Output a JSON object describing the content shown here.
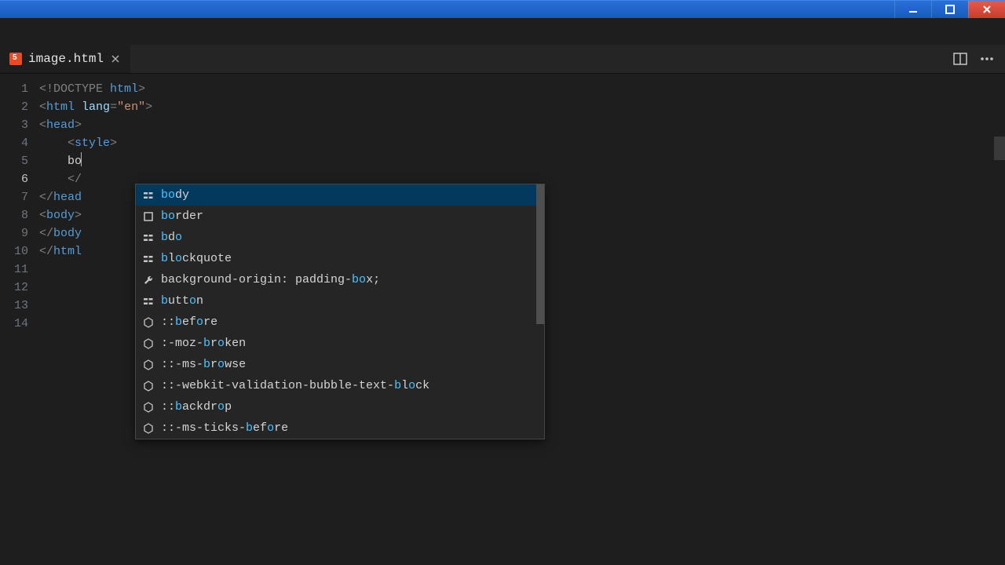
{
  "tab": {
    "filename": "image.html"
  },
  "gutter": [
    1,
    2,
    3,
    4,
    5,
    6,
    7,
    8,
    9,
    10,
    11,
    12,
    13,
    14
  ],
  "current_line": 6,
  "code": {
    "l1_pre": "<!DOCTYPE ",
    "l1_tag": "html",
    "l1_post": ">",
    "l2_pre": "<",
    "l2_tag": "html",
    "l2_sp": " ",
    "l2_attr": "lang",
    "l2_eq": "=",
    "l2_str": "\"en\"",
    "l2_post": ">",
    "l3_pre": "<",
    "l3_tag": "head",
    "l3_post": ">",
    "l4_ind": "    ",
    "l4_pre": "<",
    "l4_tag": "style",
    "l4_post": ">",
    "l5": "",
    "l6_ind": "    ",
    "l6_txt": "bo",
    "l7": "",
    "l8": "",
    "l9_ind": "    ",
    "l9_pre": "</",
    "l10_pre": "</",
    "l10_tag": "head",
    "l11_pre": "<",
    "l11_tag": "body",
    "l11_post": ">",
    "l12": "",
    "l13_pre": "</",
    "l13_tag": "body",
    "l14_pre": "</",
    "l14_tag": "html"
  },
  "suggest": {
    "items": [
      {
        "kind": "snippet",
        "pre": "bo",
        "rest": "dy"
      },
      {
        "kind": "square",
        "pre": "bo",
        "rest": "rder"
      },
      {
        "kind": "snippet",
        "pre": "b",
        "rest": "d",
        "post": "o"
      },
      {
        "kind": "snippet",
        "pre": "b",
        "rest": "l",
        "post": "o",
        "tail": "ckquote"
      },
      {
        "kind": "wrench",
        "full1": "background-origin: padding-",
        "match": "bo",
        "full2": "x;"
      },
      {
        "kind": "snippet",
        "pre": "b",
        "rest": "utt",
        "post": "o",
        "tail": "n"
      },
      {
        "kind": "hex",
        "full1": "::",
        "match": "b",
        "mid": "ef",
        "post": "o",
        "tail": "re"
      },
      {
        "kind": "hex",
        "full1": ":-moz-",
        "match": "b",
        "mid": "r",
        "post": "o",
        "tail": "ken"
      },
      {
        "kind": "hex",
        "full1": "::-ms-",
        "match": "b",
        "mid": "r",
        "post": "o",
        "tail": "wse"
      },
      {
        "kind": "hex",
        "full1": "::-webkit-validation-bubble-text-",
        "match": "b",
        "mid": "l",
        "post": "o",
        "tail": "ck"
      },
      {
        "kind": "hex",
        "full1": "::",
        "match": "b",
        "mid": "ackdr",
        "post": "o",
        "tail": "p"
      },
      {
        "kind": "hex",
        "full1": "::-ms-ticks-",
        "match": "b",
        "mid": "ef",
        "post": "o",
        "tail": "re"
      }
    ],
    "selected": 0
  }
}
